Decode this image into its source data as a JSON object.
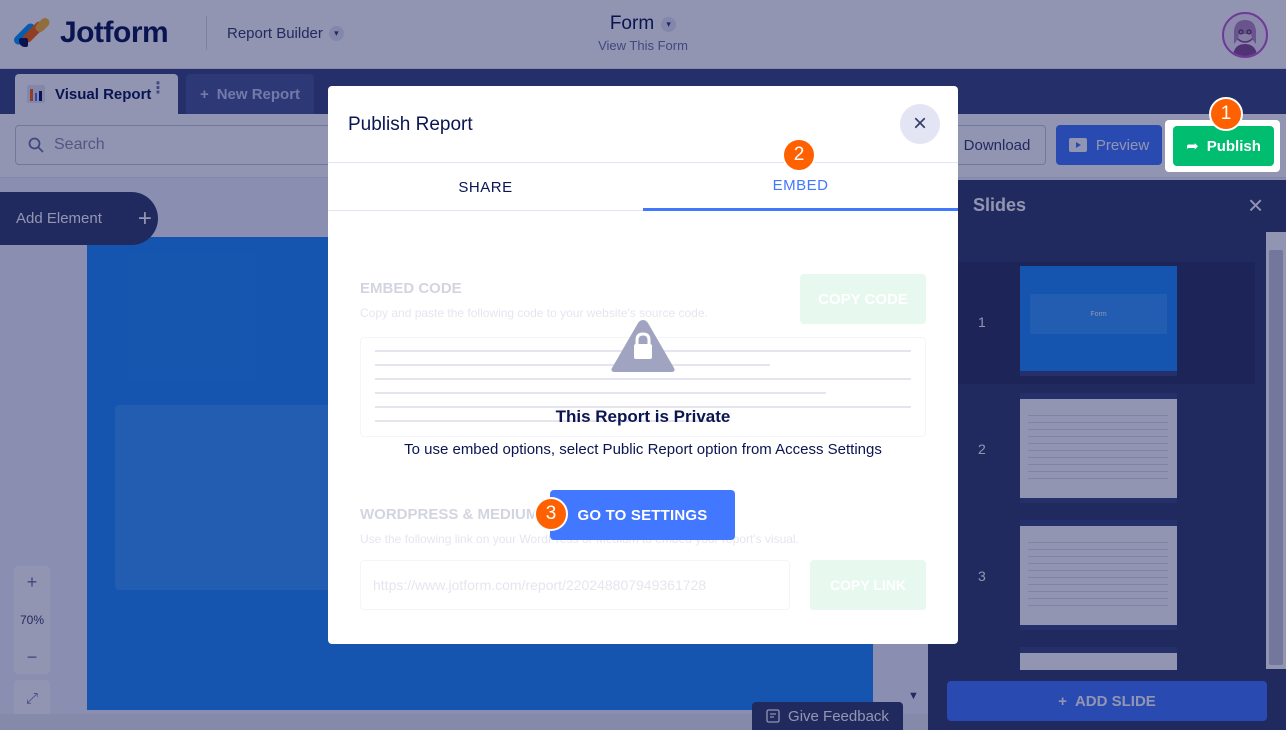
{
  "header": {
    "brand": "Jotform",
    "app_menu": "Report Builder",
    "form_title": "Form",
    "form_subtitle": "View This Form"
  },
  "report_tabs": {
    "active": "Visual Report",
    "new": "New Report"
  },
  "toolbar": {
    "search_placeholder": "Search",
    "download_label": "Download",
    "preview_label": "Preview",
    "publish_label": "Publish"
  },
  "canvas": {
    "add_element_label": "Add Element",
    "zoom_level": "70%",
    "feedback_label": "Give Feedback"
  },
  "slides_panel": {
    "title": "Slides",
    "add_slide_label": "ADD SLIDE",
    "slides": [
      {
        "number": "1",
        "thumb_title": "Form"
      },
      {
        "number": "2"
      },
      {
        "number": "3"
      }
    ]
  },
  "modal": {
    "title": "Publish Report",
    "tabs": [
      "SHARE",
      "EMBED"
    ],
    "active_tab": "EMBED",
    "background": {
      "embed_heading": "EMBED CODE",
      "embed_sub": "Copy and paste the following code to your website's source code.",
      "copy_code": "COPY CODE",
      "wp_heading": "WORDPRESS & MEDIUM",
      "wp_sub": "Use the following link on your WordPress or Medium to embed your report's visual.",
      "url": "https://www.jotform.com/report/220248807949361728",
      "copy_link": "COPY LINK"
    },
    "private_title": "This Report is Private",
    "private_desc": "To use embed options, select Public Report option from Access Settings",
    "settings_button": "GO TO SETTINGS"
  },
  "step_badges": [
    "1",
    "2",
    "3"
  ],
  "colors": {
    "accent_blue": "#4277ff",
    "publish_green": "#01bd6f",
    "step_orange": "#ff6100",
    "navy": "#0a1551"
  }
}
